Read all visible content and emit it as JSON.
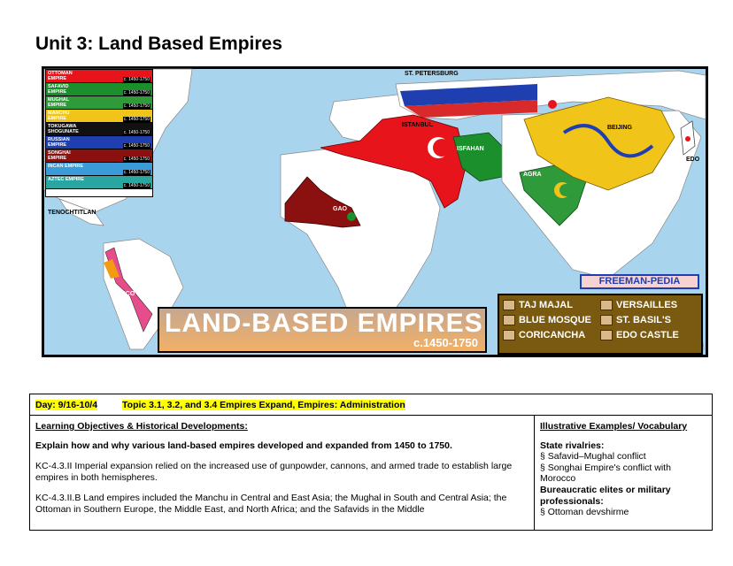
{
  "page": {
    "title": "Unit 3: Land Based Empires"
  },
  "map": {
    "legend_items": [
      {
        "name": "OTTOMAN EMPIRE",
        "dates": "c. 1450-1750",
        "color": "#e8141b"
      },
      {
        "name": "SAFAVID EMPIRE",
        "dates": "c. 1450-1750",
        "color": "#1a8f2c"
      },
      {
        "name": "MUGHAL EMPIRE",
        "dates": "c. 1450-1750",
        "color": "#2e9a3a"
      },
      {
        "name": "MANCHU EMPIRE",
        "dates": "c. 1450-1750",
        "color": "#f0c419"
      },
      {
        "name": "TOKUGAWA SHOGUNATE",
        "dates": "c. 1450-1750",
        "color": "#111111"
      },
      {
        "name": "RUSSIAN EMPIRE",
        "dates": "c. 1450-1750",
        "color": "#1f3fb0"
      },
      {
        "name": "SONGHAI EMPIRE",
        "dates": "c. 1450-1750",
        "color": "#8b1010"
      },
      {
        "name": "INCAN EMPIRE",
        "dates": "c. 1450-1750",
        "color": "#3a9bd8"
      },
      {
        "name": "AZTEC EMPIRE",
        "dates": "c. 1450-1750",
        "color": "#2aa6a0"
      }
    ],
    "places": {
      "st_petersburg": "ST. PETERSBURG",
      "istanbul": "ISTANBUL",
      "isfahan": "ISFAHAN",
      "agra": "AGRA",
      "beijing": "BEIJING",
      "edo": "EDO",
      "gao": "GAO",
      "tenochtitlan": "TENOCHTITLAN",
      "cusco": "CUSCO"
    },
    "brand": "FREEMAN-PEDIA",
    "banner_title": "LAND-BASED EMPIRES",
    "banner_dates": "c.1450-1750",
    "landmarks": [
      "TAJ MAJAL",
      "VERSAILLES",
      "BLUE MOSQUE",
      "ST. BASIL'S",
      "CORICANCHA",
      "EDO CASTLE"
    ],
    "colors": {
      "ocean": "#a9d4ee",
      "land": "#ffffff",
      "ottoman": "#e8141b",
      "safavid": "#1a8f2c",
      "mughal": "#2e9a3a",
      "manchu": "#f0c419",
      "songhai": "#8b1010",
      "landmark_box": "#7a5a10"
    }
  },
  "table": {
    "day_label": "Day:  9/16-10/4",
    "topic_label": "Topic 3.1, 3.2, and 3.4   Empires Expand, Empires: Administration",
    "objectives_heading": "Learning Objectives & Historical Developments:",
    "objective": "Explain how and why various land-based empires developed and expanded from 1450 to 1750.",
    "kc1": "KC-4.3.II Imperial expansion relied on the increased use of gunpowder, cannons, and armed trade to establish large empires in both hemispheres.",
    "kc2": "KC-4.3.II.B Land empires included the Manchu in Central and East Asia; the Mughal in South and Central Asia; the Ottoman in Southern Europe, the Middle East, and North Africa; and the Safavids in the Middle",
    "examples_heading": "Illustrative Examples/ Vocabulary",
    "state_rivalries": "State rivalries:",
    "rival1": "§ Safavid–Mughal conflict",
    "rival2": "§ Songhai Empire's conflict with Morocco",
    "elites": "Bureaucratic elites or military professionals:",
    "elite1": "§ Ottoman devshirme"
  }
}
